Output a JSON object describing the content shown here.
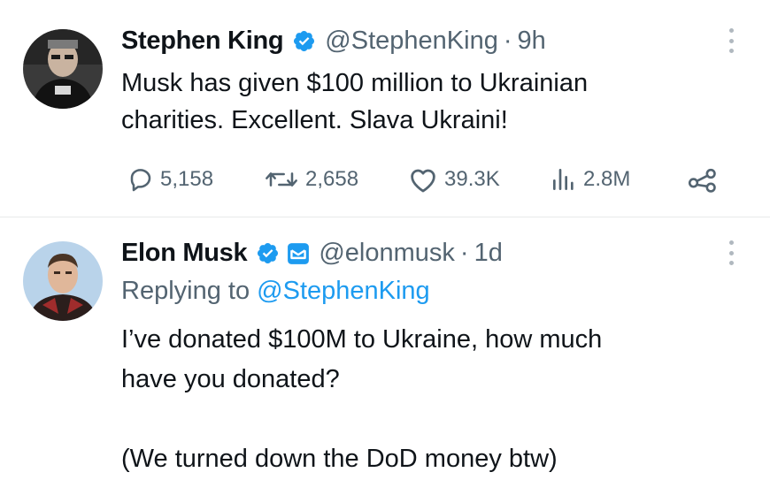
{
  "tweets": [
    {
      "display_name": "Stephen King",
      "handle": "@StephenKing",
      "separator": "·",
      "time": "9h",
      "text": "Musk has given $100 million to Ukrainian\ncharities. Excellent. Slava Ukraini!",
      "verified": true,
      "stats": {
        "replies": "5,158",
        "retweets": "2,658",
        "likes": "39.3K",
        "views": "2.8M"
      }
    },
    {
      "display_name": "Elon Musk",
      "handle": "@elonmusk",
      "separator": "·",
      "time": "1d",
      "reply_prefix": "Replying to",
      "reply_to": "@StephenKing",
      "text": "I’ve donated $100M to Ukraine, how much\nhave you donated?\n\n(We turned down the DoD money btw)",
      "verified": true
    }
  ],
  "colors": {
    "accent": "#1d9bf0",
    "secondary_text": "#536471",
    "primary_text": "#0f1419",
    "divider": "#e7e9ea"
  },
  "icons": [
    "verified-badge-icon",
    "government-badge-icon",
    "more-options-icon",
    "reply-icon",
    "retweet-icon",
    "like-icon",
    "views-icon",
    "share-icon"
  ]
}
